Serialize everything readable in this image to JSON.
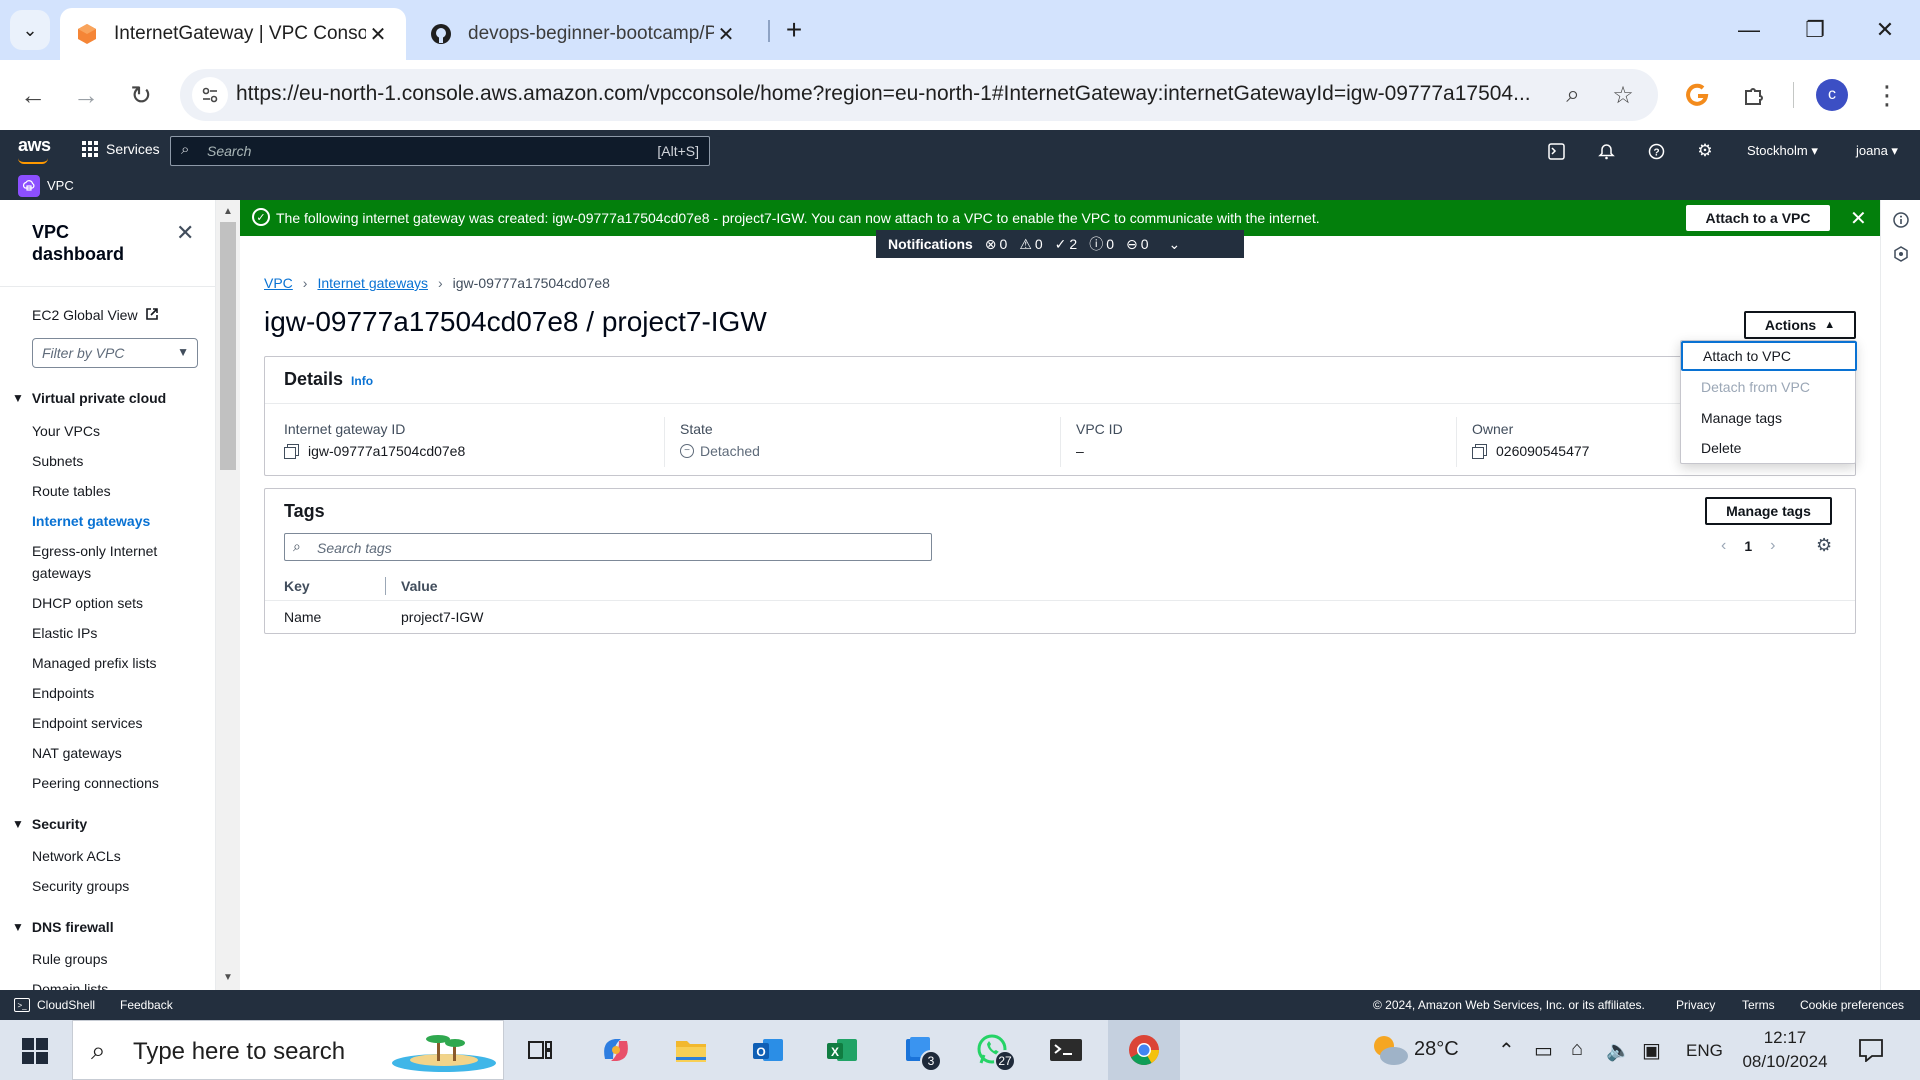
{
  "browser": {
    "tabs": [
      {
        "title": "InternetGateway | VPC Console",
        "icon": "aws-favicon-icon",
        "active": true
      },
      {
        "title": "devops-beginner-bootcamp/Pr",
        "icon": "github-icon",
        "active": false
      }
    ],
    "url": "https://eu-north-1.console.aws.amazon.com/vpcconsole/home?region=eu-north-1#InternetGateway:internetGatewayId=igw-09777a17504...",
    "profile_initial": "c"
  },
  "aws": {
    "logo": "aws",
    "services_label": "Services",
    "search_placeholder": "Search",
    "search_shortcut": "[Alt+S]",
    "region": "Stockholm",
    "user": "joana",
    "service_name": "VPC"
  },
  "sidebar": {
    "title": "VPC dashboard",
    "ec2_global_view": "EC2 Global View",
    "filter_placeholder": "Filter by VPC",
    "sections": [
      {
        "label": "Virtual private cloud",
        "items": [
          "Your VPCs",
          "Subnets",
          "Route tables",
          "Internet gateways",
          "Egress-only Internet gateways",
          "DHCP option sets",
          "Elastic IPs",
          "Managed prefix lists",
          "Endpoints",
          "Endpoint services",
          "NAT gateways",
          "Peering connections"
        ]
      },
      {
        "label": "Security",
        "items": [
          "Network ACLs",
          "Security groups"
        ]
      },
      {
        "label": "DNS firewall",
        "items": [
          "Rule groups",
          "Domain lists"
        ]
      }
    ],
    "active_item": "Internet gateways"
  },
  "banner": {
    "message": "The following internet gateway was created: igw-09777a17504cd07e8 - project7-IGW. You can now attach to a VPC to enable the VPC to communicate with the internet.",
    "button": "Attach to a VPC",
    "color": "#037f0c"
  },
  "notifications": {
    "label": "Notifications",
    "error": "0",
    "warning": "0",
    "success": "2",
    "info": "0",
    "in_progress": "0"
  },
  "breadcrumb": {
    "root": "VPC",
    "parent": "Internet gateways",
    "current": "igw-09777a17504cd07e8"
  },
  "page": {
    "title": "igw-09777a17504cd07e8 / project7-IGW",
    "actions_label": "Actions"
  },
  "actions_menu": [
    {
      "label": "Attach to VPC",
      "state": "focused"
    },
    {
      "label": "Detach from VPC",
      "state": "disabled"
    },
    {
      "label": "Manage tags",
      "state": "normal"
    },
    {
      "label": "Delete",
      "state": "normal"
    }
  ],
  "details": {
    "heading": "Details",
    "info": "Info",
    "fields": [
      {
        "label": "Internet gateway ID",
        "value": "igw-09777a17504cd07e8"
      },
      {
        "label": "State",
        "value": "Detached"
      },
      {
        "label": "VPC ID",
        "value": "–"
      },
      {
        "label": "Owner",
        "value": "026090545477"
      }
    ]
  },
  "tags": {
    "heading": "Tags",
    "manage_button": "Manage tags",
    "search_placeholder": "Search tags",
    "page": "1",
    "columns": [
      "Key",
      "Value"
    ],
    "rows": [
      {
        "key": "Name",
        "value": "project7-IGW"
      }
    ]
  },
  "footer": {
    "cloudshell": "CloudShell",
    "feedback": "Feedback",
    "copyright": "© 2024, Amazon Web Services, Inc. or its affiliates.",
    "privacy": "Privacy",
    "terms": "Terms",
    "cookies": "Cookie preferences"
  },
  "taskbar": {
    "search_placeholder": "Type here to search",
    "weather": "28°C",
    "language": "ENG",
    "time": "12:17",
    "date": "08/10/2024",
    "badges": {
      "outlook_store": "3",
      "whatsapp": "27"
    }
  }
}
